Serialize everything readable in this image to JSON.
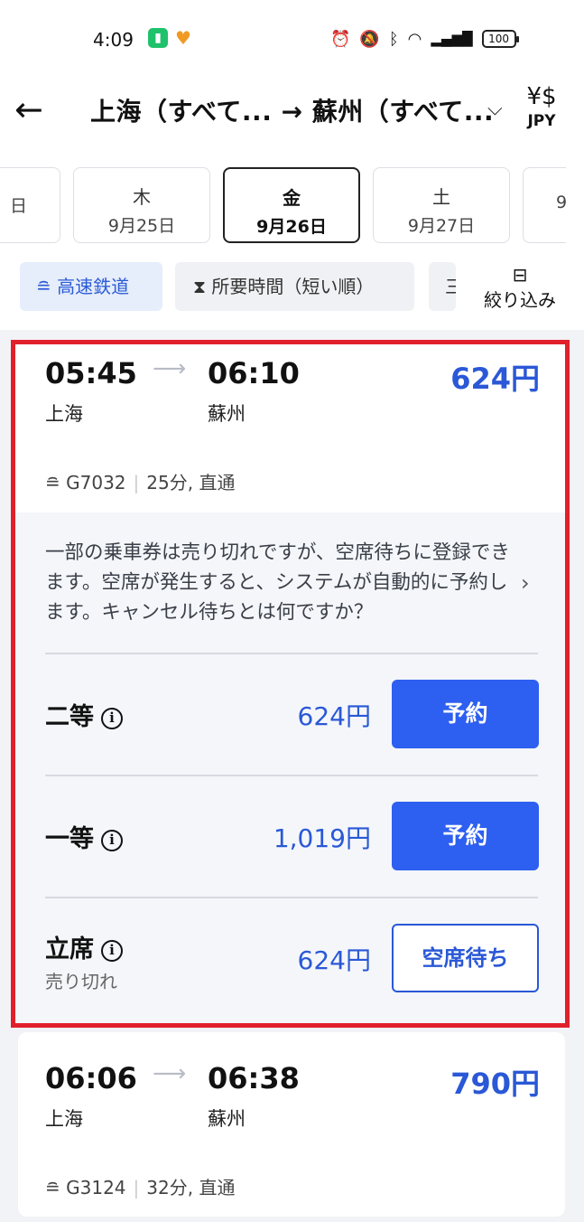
{
  "status_bar": {
    "time": "4:09",
    "battery": "100"
  },
  "header": {
    "route": "上海（すべて... → 蘇州（すべて...",
    "currency_symbol": "¥$",
    "currency_label": "JPY"
  },
  "dates": [
    {
      "dow": "",
      "date": "日"
    },
    {
      "dow": "木",
      "date": "9月25日"
    },
    {
      "dow": "金",
      "date": "9月26日",
      "selected": true
    },
    {
      "dow": "土",
      "date": "9月27日"
    },
    {
      "dow": "",
      "date": "9"
    }
  ],
  "filters": {
    "high_speed": "高速鉄道",
    "sort": "所要時間（短い順）",
    "more": "三",
    "filter_button": "絞り込み"
  },
  "trains": [
    {
      "dep_time": "05:45",
      "arr_time": "06:10",
      "dep_station": "上海",
      "arr_station": "蘇州",
      "price": "624円",
      "train_no": "G7032",
      "info": "25分, 直通",
      "notice": "一部の乗車券は売り切れですが、空席待ちに登録できます。空席が発生すると、システムが自動的に予約します。キャンセル待ちとは何ですか？",
      "classes": [
        {
          "name": "二等",
          "price": "624円",
          "action": "予約"
        },
        {
          "name": "一等",
          "price": "1,019円",
          "action": "予約"
        },
        {
          "name": "立席",
          "price": "624円",
          "action": "空席待ち",
          "status": "売り切れ"
        }
      ]
    },
    {
      "dep_time": "06:06",
      "arr_time": "06:38",
      "dep_station": "上海",
      "arr_station": "蘇州",
      "price": "790円",
      "train_no": "G3124",
      "info": "32分, 直通"
    }
  ],
  "colors": {
    "accent": "#2d5ff0",
    "highlight_border": "#e0202b",
    "price": "#2a58d6"
  }
}
